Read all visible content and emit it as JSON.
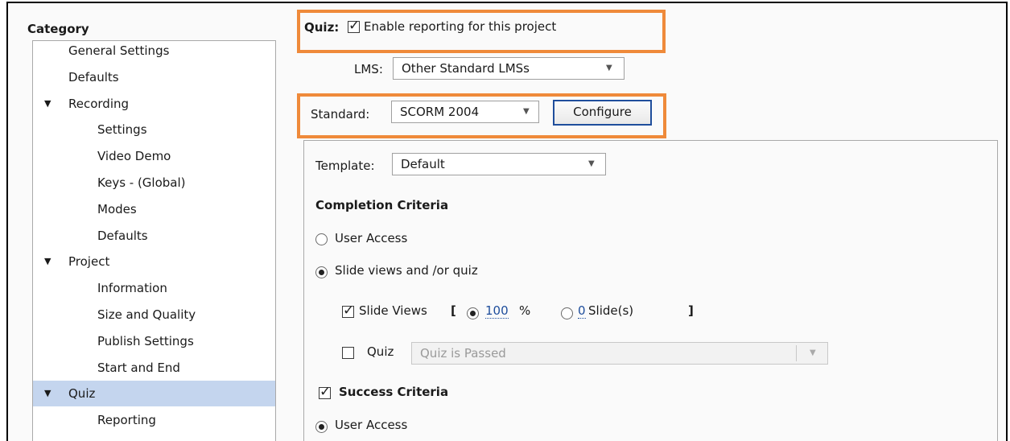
{
  "category": {
    "title": "Category",
    "items": [
      {
        "label": "General Settings",
        "level": 0,
        "expandable": false,
        "selected": false
      },
      {
        "label": "Defaults",
        "level": 0,
        "expandable": false,
        "selected": false
      },
      {
        "label": "Recording",
        "level": 0,
        "expandable": true,
        "selected": false
      },
      {
        "label": "Settings",
        "level": 1,
        "expandable": false,
        "selected": false
      },
      {
        "label": "Video Demo",
        "level": 1,
        "expandable": false,
        "selected": false
      },
      {
        "label": "Keys - (Global)",
        "level": 1,
        "expandable": false,
        "selected": false
      },
      {
        "label": "Modes",
        "level": 1,
        "expandable": false,
        "selected": false
      },
      {
        "label": "Defaults",
        "level": 1,
        "expandable": false,
        "selected": false
      },
      {
        "label": "Project",
        "level": 0,
        "expandable": true,
        "selected": false
      },
      {
        "label": "Information",
        "level": 1,
        "expandable": false,
        "selected": false
      },
      {
        "label": "Size and Quality",
        "level": 1,
        "expandable": false,
        "selected": false
      },
      {
        "label": "Publish Settings",
        "level": 1,
        "expandable": false,
        "selected": false
      },
      {
        "label": "Start and End",
        "level": 1,
        "expandable": false,
        "selected": false
      },
      {
        "label": "Quiz",
        "level": 0,
        "expandable": true,
        "selected": true
      },
      {
        "label": "Reporting",
        "level": 1,
        "expandable": false,
        "selected": false
      }
    ]
  },
  "quiz": {
    "label": "Quiz:",
    "enable_reporting_label": "Enable reporting for this project",
    "enable_reporting_checked": true
  },
  "lms": {
    "label": "LMS:",
    "value": "Other Standard LMSs"
  },
  "standard": {
    "label": "Standard:",
    "value": "SCORM 2004",
    "configure_label": "Configure"
  },
  "template": {
    "label": "Template:",
    "value": "Default"
  },
  "completion": {
    "heading": "Completion Criteria",
    "user_access_label": "User Access",
    "user_access_selected": false,
    "slide_views_quiz_label": "Slide views and /or quiz",
    "slide_views_quiz_selected": true,
    "slide_views": {
      "label": "Slide Views",
      "checked": true,
      "bracket_open": "[",
      "percent_value": "100",
      "percent_unit": "%",
      "percent_selected": true,
      "slides_value": "0",
      "slides_unit": "Slide(s)",
      "slides_selected": false,
      "bracket_close": "]"
    },
    "quiz": {
      "label": "Quiz",
      "checked": false,
      "select_value": "Quiz is Passed"
    }
  },
  "success": {
    "heading": "Success Criteria",
    "checked": true,
    "user_access_label": "User Access",
    "user_access_selected": true
  },
  "colors": {
    "highlight": "#ef8a3a",
    "selection": "#c4d5ee",
    "button_border": "#1f4e9c"
  }
}
